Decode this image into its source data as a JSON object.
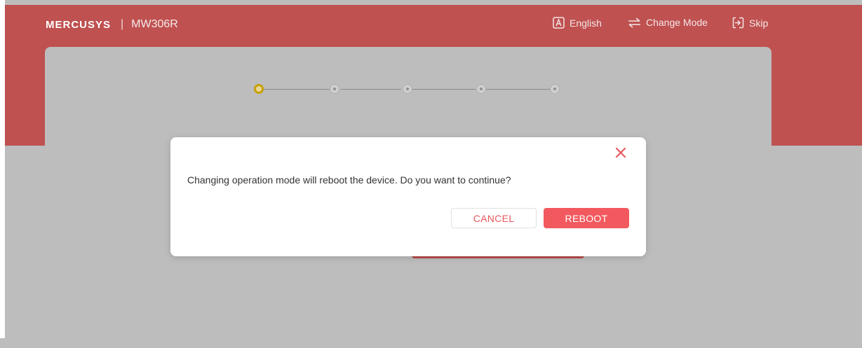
{
  "header": {
    "brand_logo": "MERCUSYS",
    "separator": "|",
    "model": "MW306R",
    "actions": [
      {
        "label": "English",
        "icon": "language-icon"
      },
      {
        "label": "Change Mode",
        "icon": "swap-arrows-icon"
      },
      {
        "label": "Skip",
        "icon": "skip-exit-icon"
      }
    ]
  },
  "stepper": {
    "total_steps": 5,
    "current_step": 1
  },
  "dialog": {
    "message": "Changing operation mode will reboot the device. Do you want to continue?",
    "cancel_label": "CANCEL",
    "reboot_label": "REBOOT",
    "close_icon": "close-icon"
  },
  "colors": {
    "header_bg": "#bf5151",
    "overlay_bg": "#bdbdbd",
    "accent": "#f2595e",
    "step_active": "#c7a000"
  }
}
